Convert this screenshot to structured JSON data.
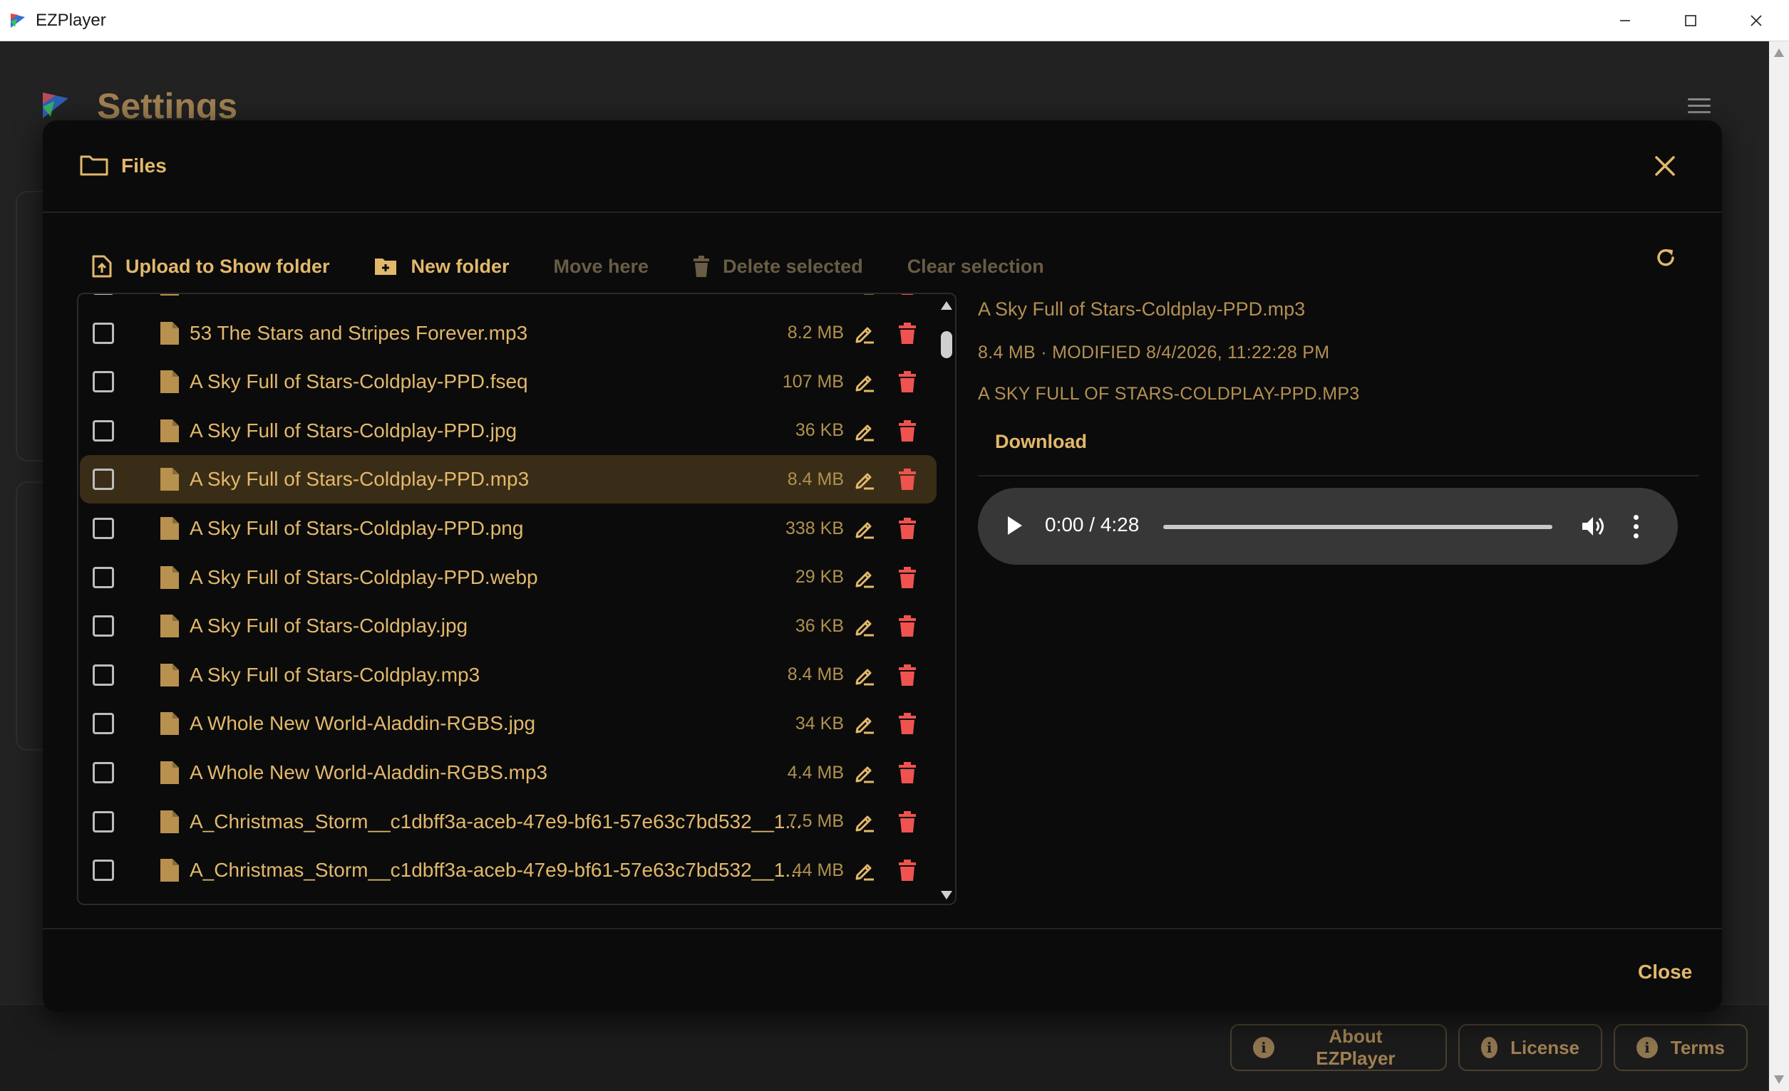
{
  "window": {
    "title": "EZPlayer"
  },
  "background": {
    "page_title": "Settings",
    "footer_buttons": [
      {
        "label": "About EZPlayer",
        "icon": "info-icon"
      },
      {
        "label": "License",
        "icon": "info-icon"
      },
      {
        "label": "Terms",
        "icon": "info-icon"
      }
    ]
  },
  "dialog": {
    "title": "Files",
    "toolbar": {
      "upload": "Upload to Show folder",
      "new_folder": "New folder",
      "move_here": "Move here",
      "delete_selected": "Delete selected",
      "clear_selection": "Clear selection"
    },
    "files": [
      {
        "name": "",
        "size": ""
      },
      {
        "name": "53 The Stars and Stripes Forever.mp3",
        "size": "8.2 MB"
      },
      {
        "name": "A Sky Full of Stars-Coldplay-PPD.fseq",
        "size": "107 MB"
      },
      {
        "name": "A Sky Full of Stars-Coldplay-PPD.jpg",
        "size": "36 KB"
      },
      {
        "name": "A Sky Full of Stars-Coldplay-PPD.mp3",
        "size": "8.4 MB",
        "selected": true
      },
      {
        "name": "A Sky Full of Stars-Coldplay-PPD.png",
        "size": "338 KB"
      },
      {
        "name": "A Sky Full of Stars-Coldplay-PPD.webp",
        "size": "29 KB"
      },
      {
        "name": "A Sky Full of Stars-Coldplay.jpg",
        "size": "36 KB"
      },
      {
        "name": "A Sky Full of Stars-Coldplay.mp3",
        "size": "8.4 MB"
      },
      {
        "name": "A Whole New World-Aladdin-RGBS.jpg",
        "size": "34 KB"
      },
      {
        "name": "A Whole New World-Aladdin-RGBS.mp3",
        "size": "4.4 MB"
      },
      {
        "name": "A_Christmas_Storm__c1dbff3a-aceb-47e9-bf61-57e63c7bd532__1...",
        "size": "7.5 MB"
      },
      {
        "name": "A_Christmas_Storm__c1dbff3a-aceb-47e9-bf61-57e63c7bd532__1...",
        "size": "44 MB"
      }
    ],
    "preview": {
      "file_name": "A Sky Full of Stars-Coldplay-PPD.mp3",
      "meta": "8.4 MB · MODIFIED 8/4/2026, 11:22:28 PM",
      "caption": "A SKY FULL OF STARS-COLDPLAY-PPD.MP3",
      "download_label": "Download",
      "player": {
        "time": "0:00 / 4:28",
        "progress": 0
      }
    },
    "close_label": "Close"
  },
  "colors": {
    "accent": "#e2b86b",
    "accent_muted": "#6a5c45",
    "delete": "#ef5350",
    "selected_row": "#3a2d17",
    "dialog_bg": "#0b0b0b"
  }
}
